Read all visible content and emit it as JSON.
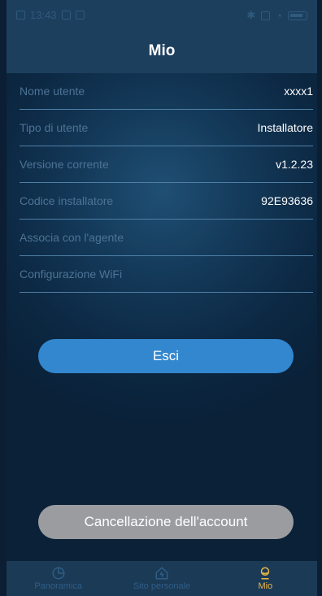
{
  "status_bar": {
    "time": "13:43"
  },
  "header": {
    "title": "Mio"
  },
  "info_rows": [
    {
      "label": "Nome utente",
      "value": "xxxx1"
    },
    {
      "label": "Tipo di utente",
      "value": "Installatore"
    },
    {
      "label": "Versione corrente",
      "value": "v1.2.23"
    },
    {
      "label": "Codice installatore",
      "value": "92E93636"
    },
    {
      "label": "Associa con l'agente",
      "value": ""
    },
    {
      "label": "Configurazione WiFi",
      "value": ""
    }
  ],
  "buttons": {
    "logout": "Esci",
    "delete_account": "Cancellazione dell'account"
  },
  "tabbar": {
    "items": [
      {
        "label": "Panoramica",
        "icon": "pie-chart-icon"
      },
      {
        "label": "Sito personale",
        "icon": "home-icon"
      },
      {
        "label": "Mio",
        "icon": "user-icon"
      }
    ],
    "active": "Mio"
  },
  "colors": {
    "header_bg": "#1d3f5e",
    "accent_button": "#3287cf",
    "delete_button": "#9a9ca0",
    "active_tab": "#e8b54a",
    "inactive_tab": "#2f5d86"
  }
}
